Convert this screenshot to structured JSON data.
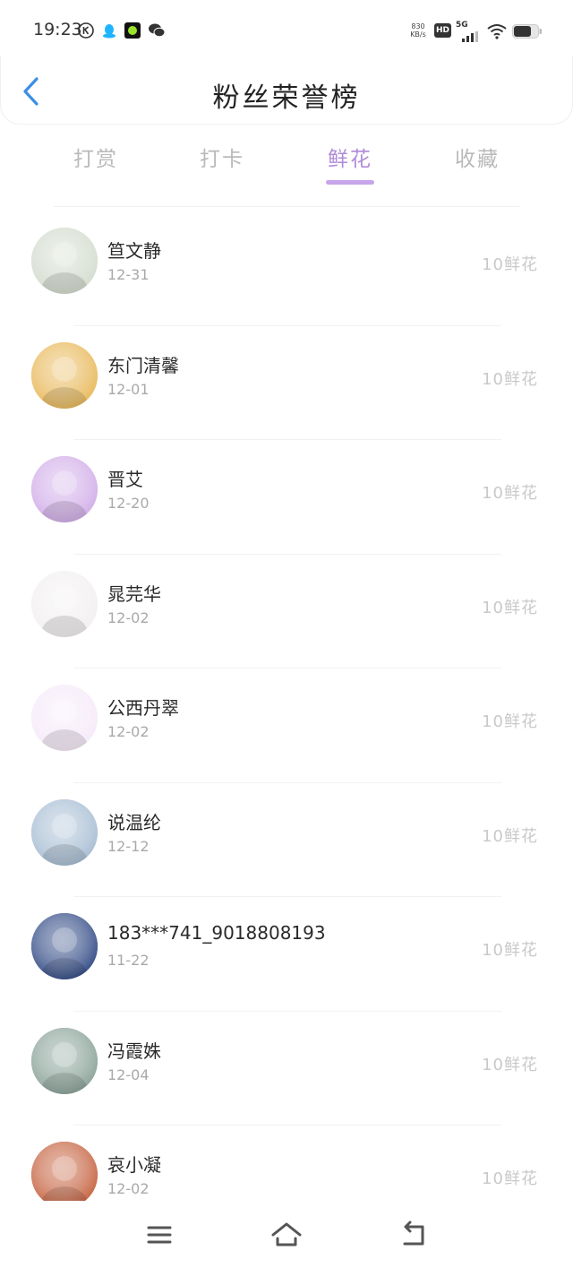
{
  "status_bar": {
    "time": "19:23",
    "net_speed_value": "830",
    "net_speed_unit": "KB/s",
    "hd_label": "HD",
    "network_label": "5G",
    "left_icons": [
      "k-circle-icon",
      "qq-penguin-icon",
      "green-app-icon",
      "wechat-icon"
    ],
    "right_icons": [
      "hd-icon",
      "signal-icon",
      "wifi-icon",
      "battery-icon"
    ]
  },
  "header": {
    "back_icon": "chevron-left-icon",
    "title": "粉丝荣誉榜"
  },
  "tabs": [
    {
      "label": "打赏",
      "active": false
    },
    {
      "label": "打卡",
      "active": false
    },
    {
      "label": "鲜花",
      "active": true
    },
    {
      "label": "收藏",
      "active": false
    }
  ],
  "fans": [
    {
      "name": "笪文静",
      "date": "12-31",
      "amount": "10鲜花",
      "avatar_color": "#cfd8c9"
    },
    {
      "name": "东门清馨",
      "date": "12-01",
      "amount": "10鲜花",
      "avatar_color": "#e6b24a"
    },
    {
      "name": "晋艾",
      "date": "12-20",
      "amount": "10鲜花",
      "avatar_color": "#cda6e6"
    },
    {
      "name": "晁芫华",
      "date": "12-02",
      "amount": "10鲜花",
      "avatar_color": "#f1eeee"
    },
    {
      "name": "公西丹翠",
      "date": "12-02",
      "amount": "10鲜花",
      "avatar_color": "#f4e8f8"
    },
    {
      "name": "说温纶",
      "date": "12-12",
      "amount": "10鲜花",
      "avatar_color": "#9fb7cf"
    },
    {
      "name": "183***741_9018808193",
      "date": "11-22",
      "amount": "10鲜花",
      "avatar_color": "#1f3a7a"
    },
    {
      "name": "冯霞姝",
      "date": "12-04",
      "amount": "10鲜花",
      "avatar_color": "#7f9a8f"
    },
    {
      "name": "哀小凝",
      "date": "12-02",
      "amount": "10鲜花",
      "avatar_color": "#c0542e"
    }
  ],
  "bottom_nav": [
    "menu-icon",
    "home-icon",
    "back-icon"
  ],
  "colors": {
    "accent": "#b08ad8",
    "indicator": "#c7a5ea",
    "back_arrow": "#3a8ee6",
    "muted_text": "#c9c9c9"
  }
}
